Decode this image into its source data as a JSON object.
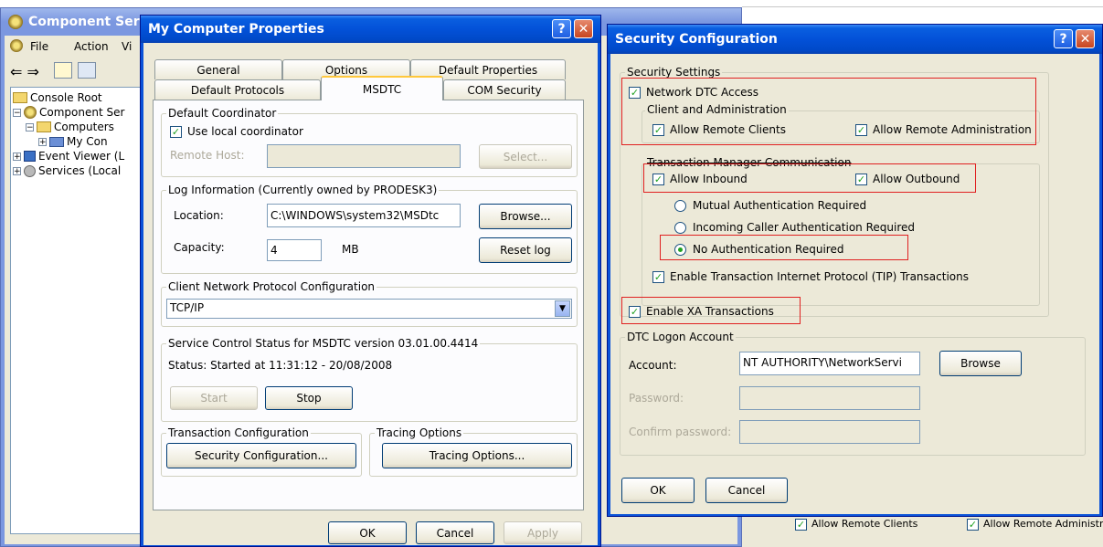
{
  "mmc": {
    "title": "Component Ser",
    "menu": {
      "file": "File",
      "action": "Action",
      "view": "Vi"
    },
    "toolbar_arrows": "⇐ ⇒",
    "tree": [
      {
        "label": "Console Root"
      },
      {
        "label": "Component Ser"
      },
      {
        "label": "Computers"
      },
      {
        "label": "My Con"
      },
      {
        "label": "Event Viewer (L"
      },
      {
        "label": "Services (Local"
      }
    ]
  },
  "props": {
    "title": "My Computer Properties",
    "tabs_back": [
      "General",
      "Options",
      "Default Properties"
    ],
    "tabs_front": [
      "Default Protocols",
      "MSDTC",
      "COM Security"
    ],
    "default_coordinator": {
      "group": "Default Coordinator",
      "use_local": "Use local coordinator",
      "remote_host_label": "Remote Host:",
      "select": "Select..."
    },
    "log": {
      "group": "Log Information (Currently owned by PRODESK3)",
      "location_label": "Location:",
      "location_value": "C:\\WINDOWS\\system32\\MSDtc",
      "browse": "Browse...",
      "capacity_label": "Capacity:",
      "capacity_value": "4",
      "mb": "MB",
      "reset": "Reset log"
    },
    "protocol": {
      "group": "Client Network Protocol Configuration",
      "value": "TCP/IP"
    },
    "service": {
      "group": "Service Control Status for MSDTC version 03.01.00.4414",
      "status": "Status: Started at 11:31:12 - 20/08/2008",
      "start": "Start",
      "stop": "Stop"
    },
    "transaction": {
      "group": "Transaction Configuration",
      "button": "Security Configuration..."
    },
    "tracing": {
      "group": "Tracing Options",
      "button": "Tracing Options..."
    },
    "ok": "OK",
    "cancel": "Cancel",
    "apply": "Apply"
  },
  "security": {
    "title": "Security Configuration",
    "settings_group": "Security Settings",
    "network_dtc": "Network DTC Access",
    "client_admin_group": "Client and Administration",
    "allow_remote_clients": "Allow Remote Clients",
    "allow_remote_admin": "Allow Remote Administration",
    "tmc_group": "Transaction Manager Communication",
    "allow_inbound": "Allow Inbound",
    "allow_outbound": "Allow Outbound",
    "mutual": "Mutual Authentication Required",
    "incoming": "Incoming Caller Authentication Required",
    "none": "No Authentication Required",
    "tip": "Enable Transaction Internet Protocol (TIP) Transactions",
    "xa": "Enable XA Transactions",
    "logon_group": "DTC Logon Account",
    "account_label": "Account:",
    "account_value": "NT AUTHORITY\\NetworkServi",
    "browse": "Browse",
    "password_label": "Password:",
    "confirm_label": "Confirm password:",
    "ok": "OK",
    "cancel": "Cancel"
  },
  "background": {
    "allow_remote_clients": "Allow Remote Clients",
    "allow_remote_admin": "Allow Remote Administra"
  }
}
